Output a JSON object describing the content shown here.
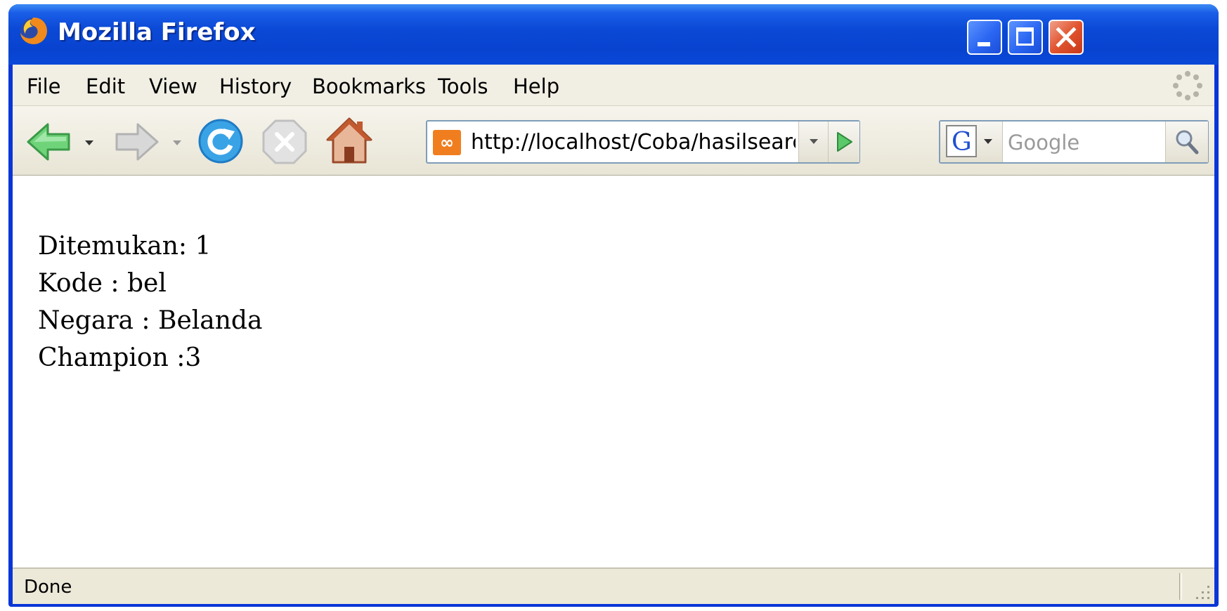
{
  "window": {
    "title": "Mozilla Firefox"
  },
  "menu": [
    {
      "label": "File"
    },
    {
      "label": "Edit"
    },
    {
      "label": "View"
    },
    {
      "label": "History"
    },
    {
      "label": "Bookmarks"
    },
    {
      "label": "Tools"
    },
    {
      "label": "Help"
    }
  ],
  "toolbar": {
    "url": "http://localhost/Coba/hasilsearch.p",
    "search_placeholder": "Google"
  },
  "page": {
    "lines": [
      {
        "text": "Ditemukan: 1"
      },
      {
        "text": "Kode : bel"
      },
      {
        "text": "Negara : Belanda"
      },
      {
        "text": "Champion :3"
      }
    ]
  },
  "status": {
    "text": "Done"
  }
}
